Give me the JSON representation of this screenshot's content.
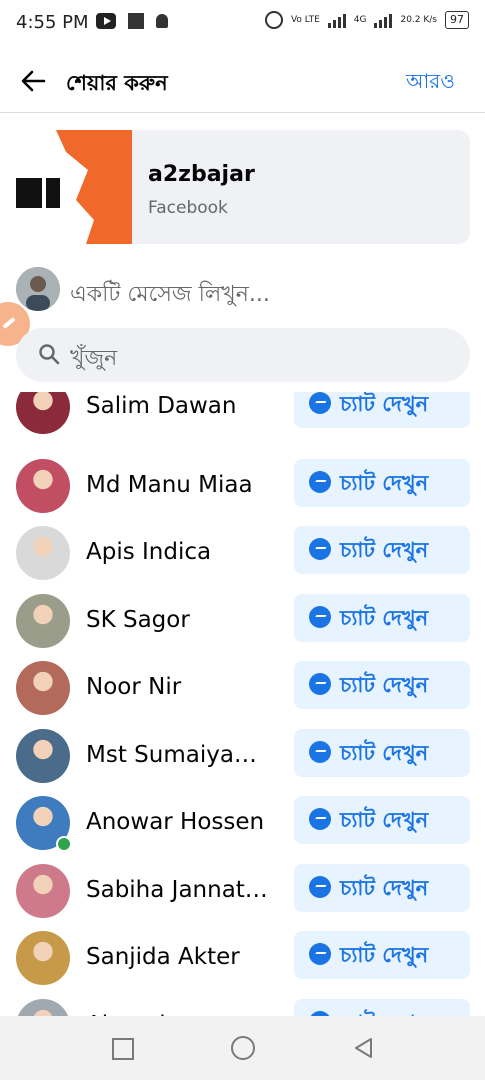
{
  "status": {
    "time": "4:55 PM",
    "net_a": "Vo LTE",
    "net_b": "4G",
    "speed": "20.2 K/s",
    "battery": "97"
  },
  "header": {
    "title": "শেয়ার করুন",
    "more_label": "আরও"
  },
  "share_card": {
    "title": "a2zbajar",
    "subtitle": "Facebook"
  },
  "message": {
    "placeholder": "একটি মেসেজ লিখুন..."
  },
  "search": {
    "placeholder": "খুঁজুন"
  },
  "contacts": [
    {
      "name": "Salim Dawan",
      "online": false,
      "color": "#8b2a3a"
    },
    {
      "name": "Md Manu Miaa",
      "online": false,
      "color": "#c14e63"
    },
    {
      "name": "Apis Indica",
      "online": false,
      "color": "#d9d9d9"
    },
    {
      "name": "SK Sagor",
      "online": false,
      "color": "#9a9d8a"
    },
    {
      "name": "Noor Nir",
      "online": false,
      "color": "#b36a5a"
    },
    {
      "name": "Mst Sumaiya…",
      "online": false,
      "color": "#4a6b8a"
    },
    {
      "name": "Anowar Hossen",
      "online": true,
      "color": "#3e7bbf"
    },
    {
      "name": "Sabiha Jannat…",
      "online": false,
      "color": "#cf7a8a"
    },
    {
      "name": "Sanjida Akter",
      "online": false,
      "color": "#c79a4a"
    },
    {
      "name": "Alomgir",
      "online": false,
      "color": "#a0a8b0"
    }
  ],
  "chat_label": "চ্যাট দেখুন",
  "colors": {
    "accent": "#1a74e4",
    "chat_bg": "#e7f3ff",
    "surface": "#eff1f4"
  }
}
